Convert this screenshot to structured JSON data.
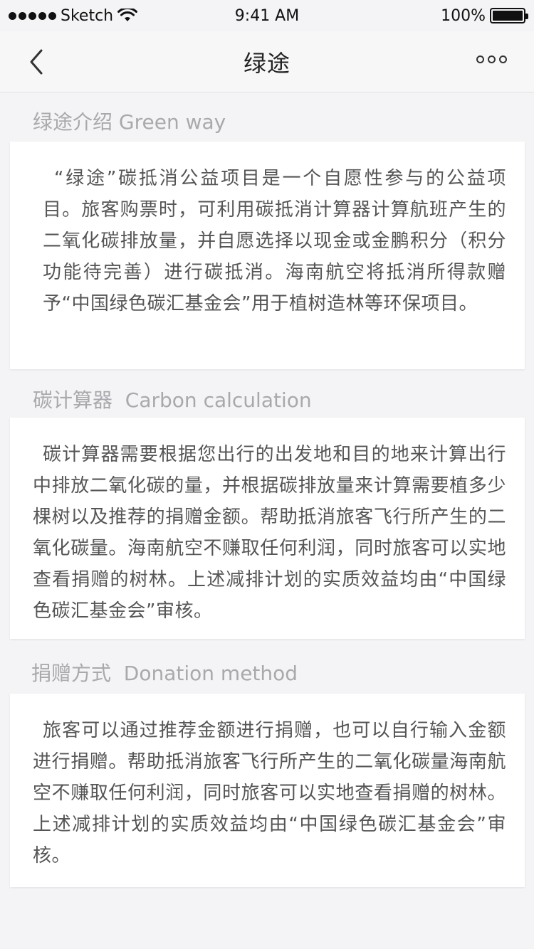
{
  "status_bar": {
    "carrier": "Sketch",
    "time": "9:41 AM",
    "battery": "100%"
  },
  "nav": {
    "title": "绿途",
    "back_icon": "chevron-left-icon",
    "more_icon": "more-horizontal-icon"
  },
  "sections": [
    {
      "title": "绿途介绍 Green way",
      "body": "“绿途”碳抵消公益项目是一个自愿性参与的公益项目。旅客购票时，可利用碳抵消计算器计算航班产生的二氧化碳排放量，并自愿选择以现金或金鹏积分（积分功能待完善）进行碳抵消。海南航空将抵消所得款赠予“中国绿色碳汇基金会”用于植树造林等环保项目。"
    },
    {
      "title": "碳计算器  Carbon calculation",
      "body": "碳计算器需要根据您出行的出发地和目的地来计算出行中排放二氧化碳的量，并根据碳排放量来计算需要植多少棵树以及推荐的捐赠金额。帮助抵消旅客飞行所产生的二氧化碳量。海南航空不赚取任何利润，同时旅客可以实地查看捐赠的树林。上述减排计划的实质效益均由“中国绿色碳汇基金会”审核。"
    },
    {
      "title": "捐赠方式  Donation method",
      "body": "旅客可以通过推荐金额进行捐赠，也可以自行输入金额进行捐赠。帮助抵消旅客飞行所产生的二氧化碳量海南航空不赚取任何利润，同时旅客可以实地查看捐赠的树林。上述减排计划的实质效益均由“中国绿色碳汇基金会”审核。"
    }
  ]
}
